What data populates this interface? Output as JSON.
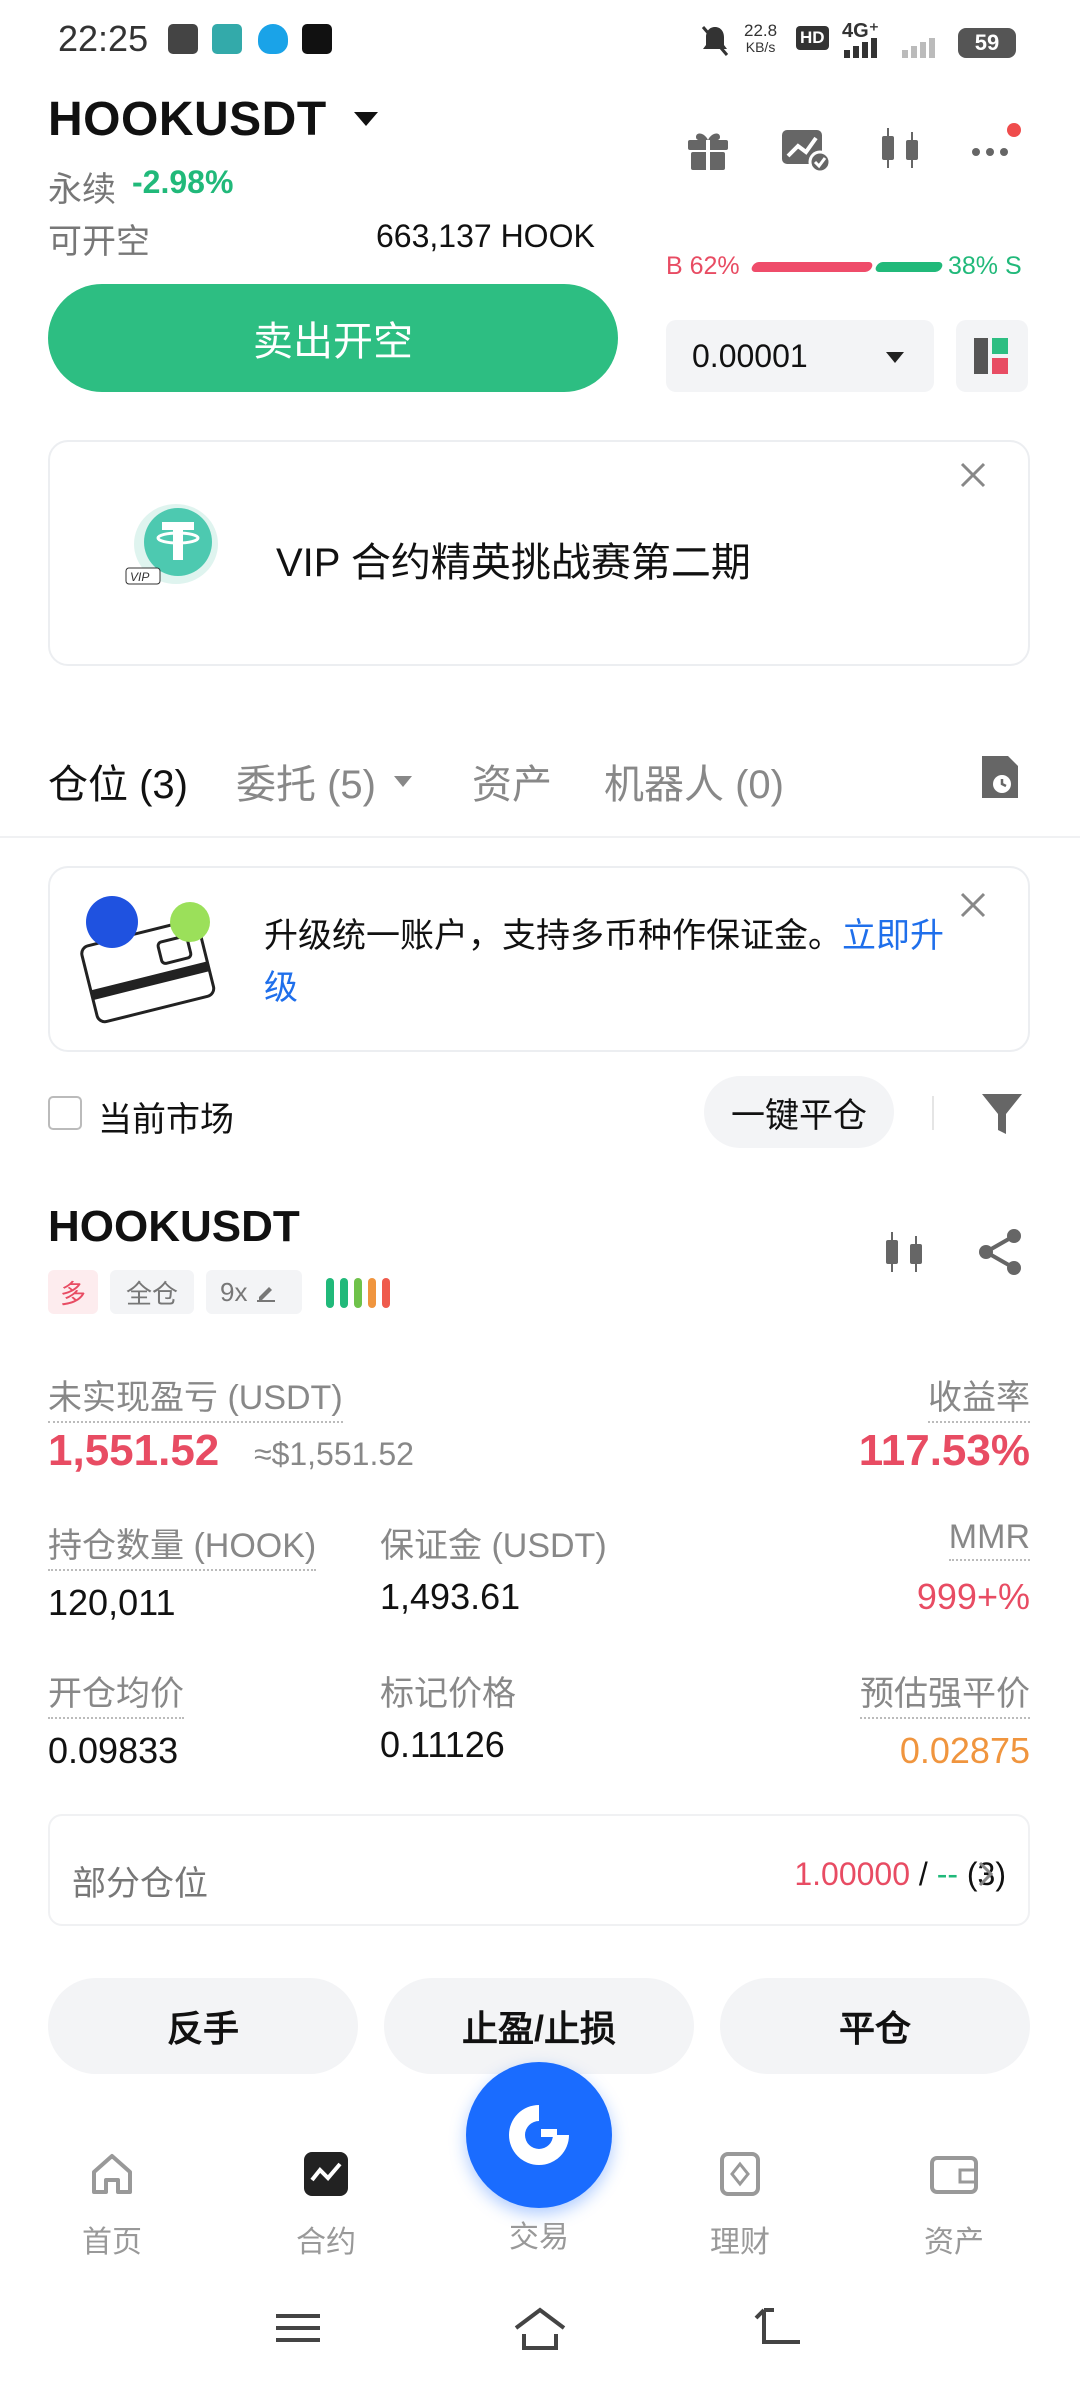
{
  "status_bar": {
    "time": "22:25",
    "net_speed": "22.8",
    "net_unit": "KB/s",
    "hd": "HD",
    "network": "4G⁺",
    "battery": "59"
  },
  "header": {
    "symbol": "HOOKUSDT",
    "contract_type": "永续",
    "change": "-2.98%",
    "short_label": "可开空",
    "short_amount": "663,137 HOOK",
    "sell_button": "卖出开空",
    "buy_ratio": "B 62%",
    "sell_ratio": "38% S",
    "precision": "0.00001"
  },
  "vip_banner": {
    "badge": "VIP",
    "text": "VIP 合约精英挑战赛第二期"
  },
  "tabs": [
    {
      "label": "仓位 (3)"
    },
    {
      "label": "委托 (5)"
    },
    {
      "label": "资产"
    },
    {
      "label": "机器人 (0)"
    }
  ],
  "upgrade_banner": {
    "text": "升级统一账户，支持多币种作保证金。",
    "link": "立即升级"
  },
  "filters": {
    "current_market": "当前市场",
    "close_all": "一键平仓"
  },
  "position": {
    "symbol": "HOOKUSDT",
    "side": "多",
    "margin_mode": "全仓",
    "leverage": "9x",
    "unrealized_pnl_label": "未实现盈亏 (USDT)",
    "unrealized_pnl": "1,551.52",
    "unrealized_pnl_usd": "≈$1,551.52",
    "roe_label": "收益率",
    "roe": "117.53%",
    "size_label": "持仓数量 (HOOK)",
    "size": "120,011",
    "margin_label": "保证金 (USDT)",
    "margin": "1,493.61",
    "mmr_label": "MMR",
    "mmr": "999+%",
    "entry_label": "开仓均价",
    "entry": "0.09833",
    "mark_label": "标记价格",
    "mark": "0.11126",
    "liq_label": "预估强平价",
    "liq": "0.02875",
    "partial_label": "部分仓位",
    "partial_value": "1.00000",
    "partial_sep": " / ",
    "partial_dash": "--",
    "partial_count": " (3)",
    "buttons": {
      "reverse": "反手",
      "tpsl": "止盈/止损",
      "close": "平仓"
    }
  },
  "bottom_nav": [
    {
      "label": "首页",
      "icon": "home-icon"
    },
    {
      "label": "合约",
      "icon": "futures-icon"
    },
    {
      "label": "交易",
      "icon": "trade-icon"
    },
    {
      "label": "理财",
      "icon": "earn-icon"
    },
    {
      "label": "资产",
      "icon": "wallet-icon"
    }
  ],
  "colors": {
    "green": "#2dbe82",
    "red": "#e84c63",
    "orange": "#f0953e",
    "blue": "#1a6cff"
  }
}
